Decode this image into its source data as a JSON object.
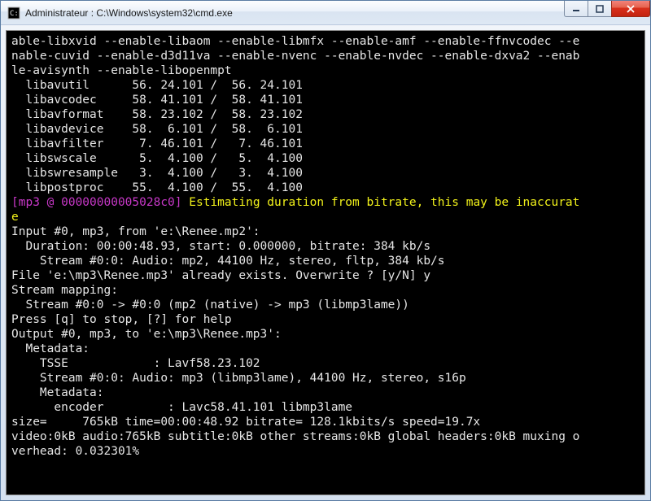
{
  "window": {
    "title": "Administrateur : C:\\Windows\\system32\\cmd.exe"
  },
  "colors": {
    "magenta": "#c838c8",
    "yellow": "#f2f21a",
    "console_bg": "#000000",
    "console_fg": "#e6e6e6"
  },
  "console": {
    "configure_flags": "able-libxvid --enable-libaom --enable-libmfx --enable-amf --enable-ffnvcodec --e\nnable-cuvid --enable-d3d11va --enable-nvenc --enable-nvdec --enable-dxva2 --enab\nle-avisynth --enable-libopenmpt",
    "libs": [
      {
        "name": "libavutil",
        "left": "56. 24.101",
        "right": "56. 24.101"
      },
      {
        "name": "libavcodec",
        "left": "58. 41.101",
        "right": "58. 41.101"
      },
      {
        "name": "libavformat",
        "left": "58. 23.102",
        "right": "58. 23.102"
      },
      {
        "name": "libavdevice",
        "left": "58.  6.101",
        "right": "58.  6.101"
      },
      {
        "name": "libavfilter",
        "left": " 7. 46.101",
        "right": " 7. 46.101"
      },
      {
        "name": "libswscale",
        "left": " 5.  4.100",
        "right": " 5.  4.100"
      },
      {
        "name": "libswresample",
        "left": " 3.  4.100",
        "right": " 3.  4.100"
      },
      {
        "name": "libpostproc",
        "left": "55.  4.100",
        "right": "55.  4.100"
      }
    ],
    "warn_tag": "[mp3 @ 00000000005028c0] ",
    "warn_msg": "Estimating duration from bitrate, this may be inaccurat\ne",
    "input_header": "Input #0, mp3, from 'e:\\Renee.mp2':",
    "input_duration": "  Duration: 00:00:48.93, start: 0.000000, bitrate: 384 kb/s",
    "input_stream": "    Stream #0:0: Audio: mp2, 44100 Hz, stereo, fltp, 384 kb/s",
    "overwrite_prompt": "File 'e:\\mp3\\Renee.mp3' already exists. Overwrite ? [y/N] y",
    "stream_mapping_header": "Stream mapping:",
    "stream_mapping_line": "  Stream #0:0 -> #0:0 (mp2 (native) -> mp3 (libmp3lame))",
    "press_help": "Press [q] to stop, [?] for help",
    "output_header": "Output #0, mp3, to 'e:\\mp3\\Renee.mp3':",
    "metadata1": "  Metadata:",
    "tsse": "    TSSE            : Lavf58.23.102",
    "output_stream": "    Stream #0:0: Audio: mp3 (libmp3lame), 44100 Hz, stereo, s16p",
    "metadata2": "    Metadata:",
    "encoder": "      encoder         : Lavc58.41.101 libmp3lame",
    "size_line": "size=     765kB time=00:00:48.92 bitrate= 128.1kbits/s speed=19.7x",
    "summary": "video:0kB audio:765kB subtitle:0kB other streams:0kB global headers:0kB muxing o\nverhead: 0.032301%"
  }
}
